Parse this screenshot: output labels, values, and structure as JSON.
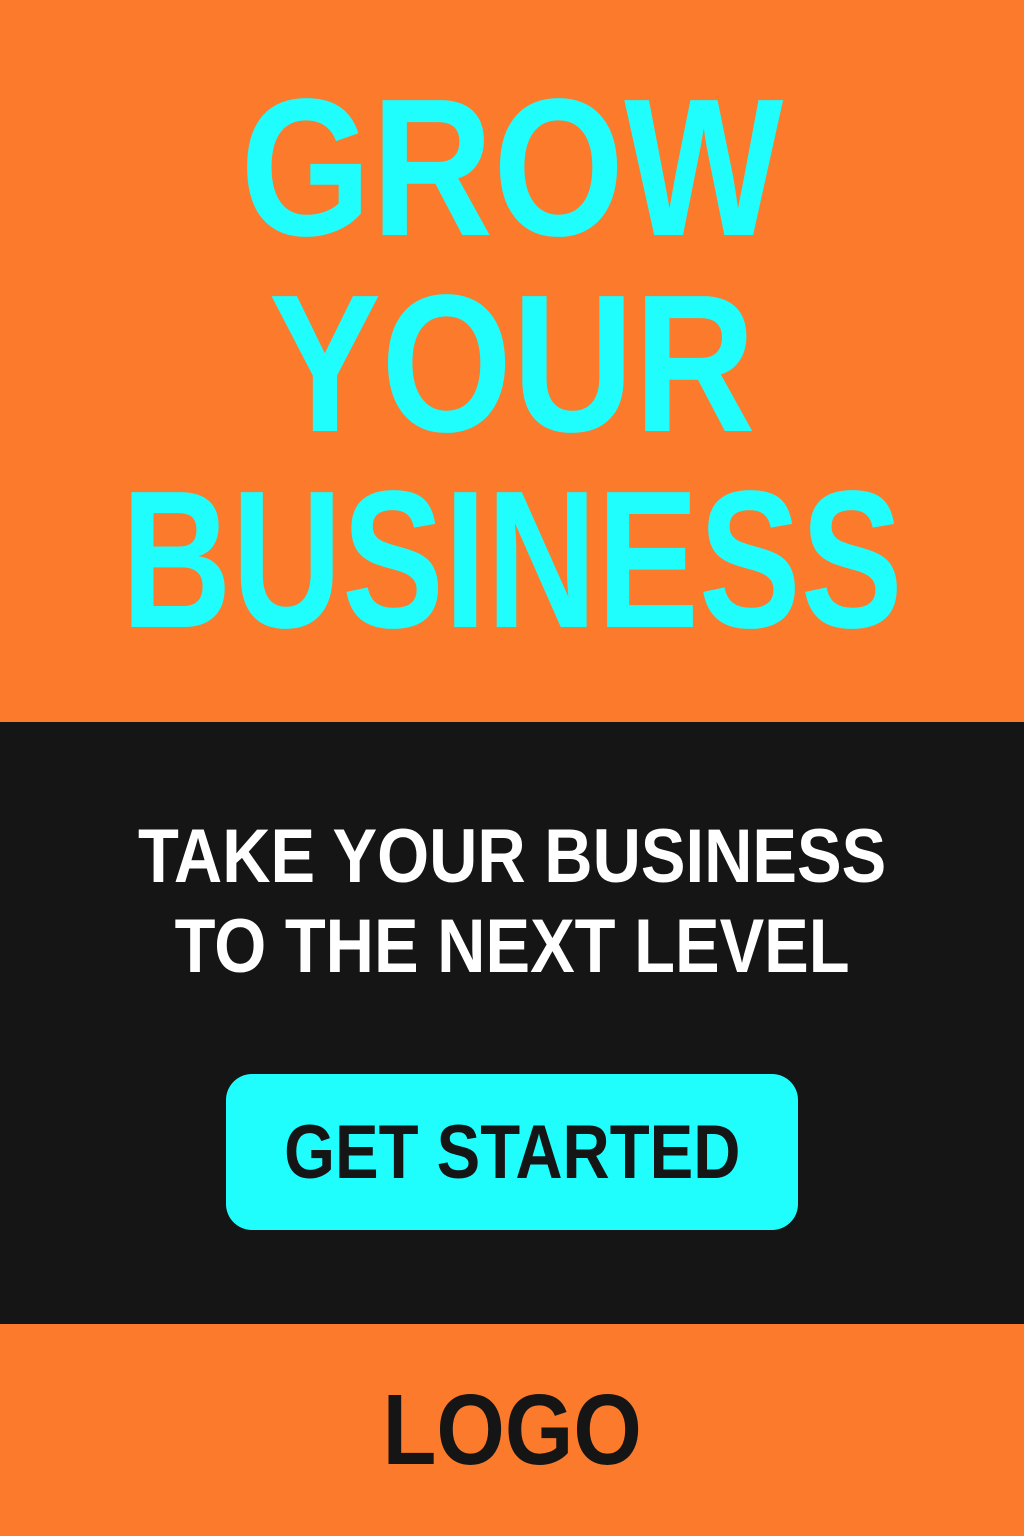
{
  "colors": {
    "accent": "#1FFDFD",
    "orange": "#FB7A2C",
    "dark": "#151515",
    "white": "#FFFFFF"
  },
  "hero": {
    "headline_lines": [
      "GROW",
      "YOUR",
      "BUSINESS"
    ]
  },
  "middle": {
    "tagline_lines": [
      "TAKE YOUR BUSINESS",
      "TO THE NEXT LEVEL"
    ],
    "cta_label": "GET STARTED"
  },
  "footer": {
    "logo_text": "LOGO"
  }
}
